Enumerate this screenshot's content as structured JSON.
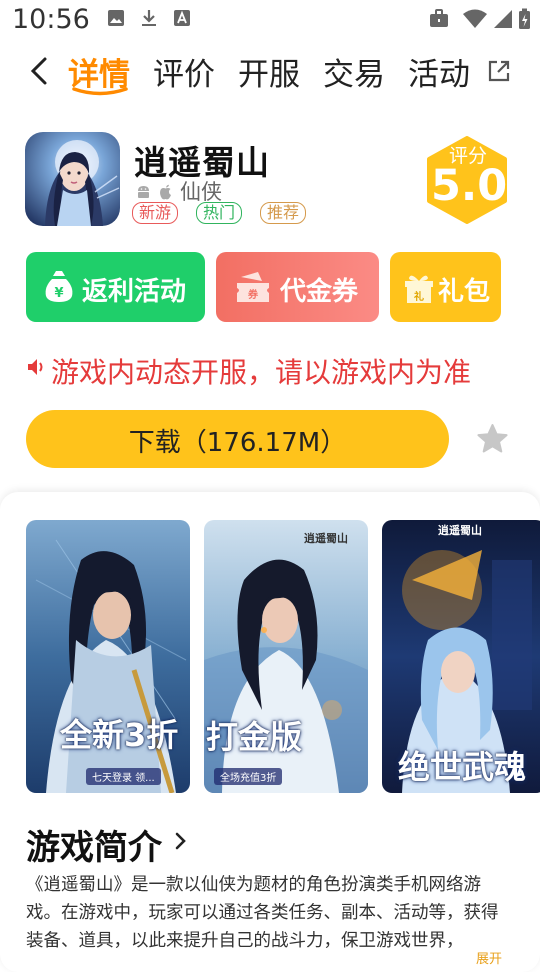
{
  "status_bar": {
    "time": "10:56"
  },
  "nav": {
    "tabs": [
      "详情",
      "评价",
      "开服",
      "交易",
      "活动"
    ],
    "active_tab": 0,
    "accent": "#ff8a00"
  },
  "game": {
    "name": "逍遥蜀山",
    "genre": "仙侠",
    "platforms": [
      "android-icon",
      "apple-icon"
    ],
    "tags": [
      "新游",
      "热门",
      "推荐"
    ],
    "rating_label": "评分",
    "rating_value": "5.0"
  },
  "actions": {
    "rebate": "返利活动",
    "voucher": "代金券",
    "gift": "礼包",
    "voucher_icon_text": "券",
    "gift_icon_text": "礼",
    "rebate_icon_text": "¥"
  },
  "notice": {
    "text": "游戏内动态开服，请以游戏内为准"
  },
  "download": {
    "label": "下载（176.17M）"
  },
  "screenshots": [
    {
      "caption": "全新3折",
      "sub": "七天登录 领..."
    },
    {
      "caption": "打金版",
      "sub": "全场充值3折",
      "logo": "逍遥蜀山"
    },
    {
      "caption": "绝世武魂",
      "logo": "逍遥蜀山"
    }
  ],
  "intro": {
    "title": "游戏简介",
    "text": "《逍遥蜀山》是一款以仙侠为题材的角色扮演类手机网络游戏。在游戏中，玩家可以通过各类任务、副本、活动等，获得装备、道具，以此来提升自己的战斗力，保卫游戏世界，",
    "expand": "展开"
  }
}
